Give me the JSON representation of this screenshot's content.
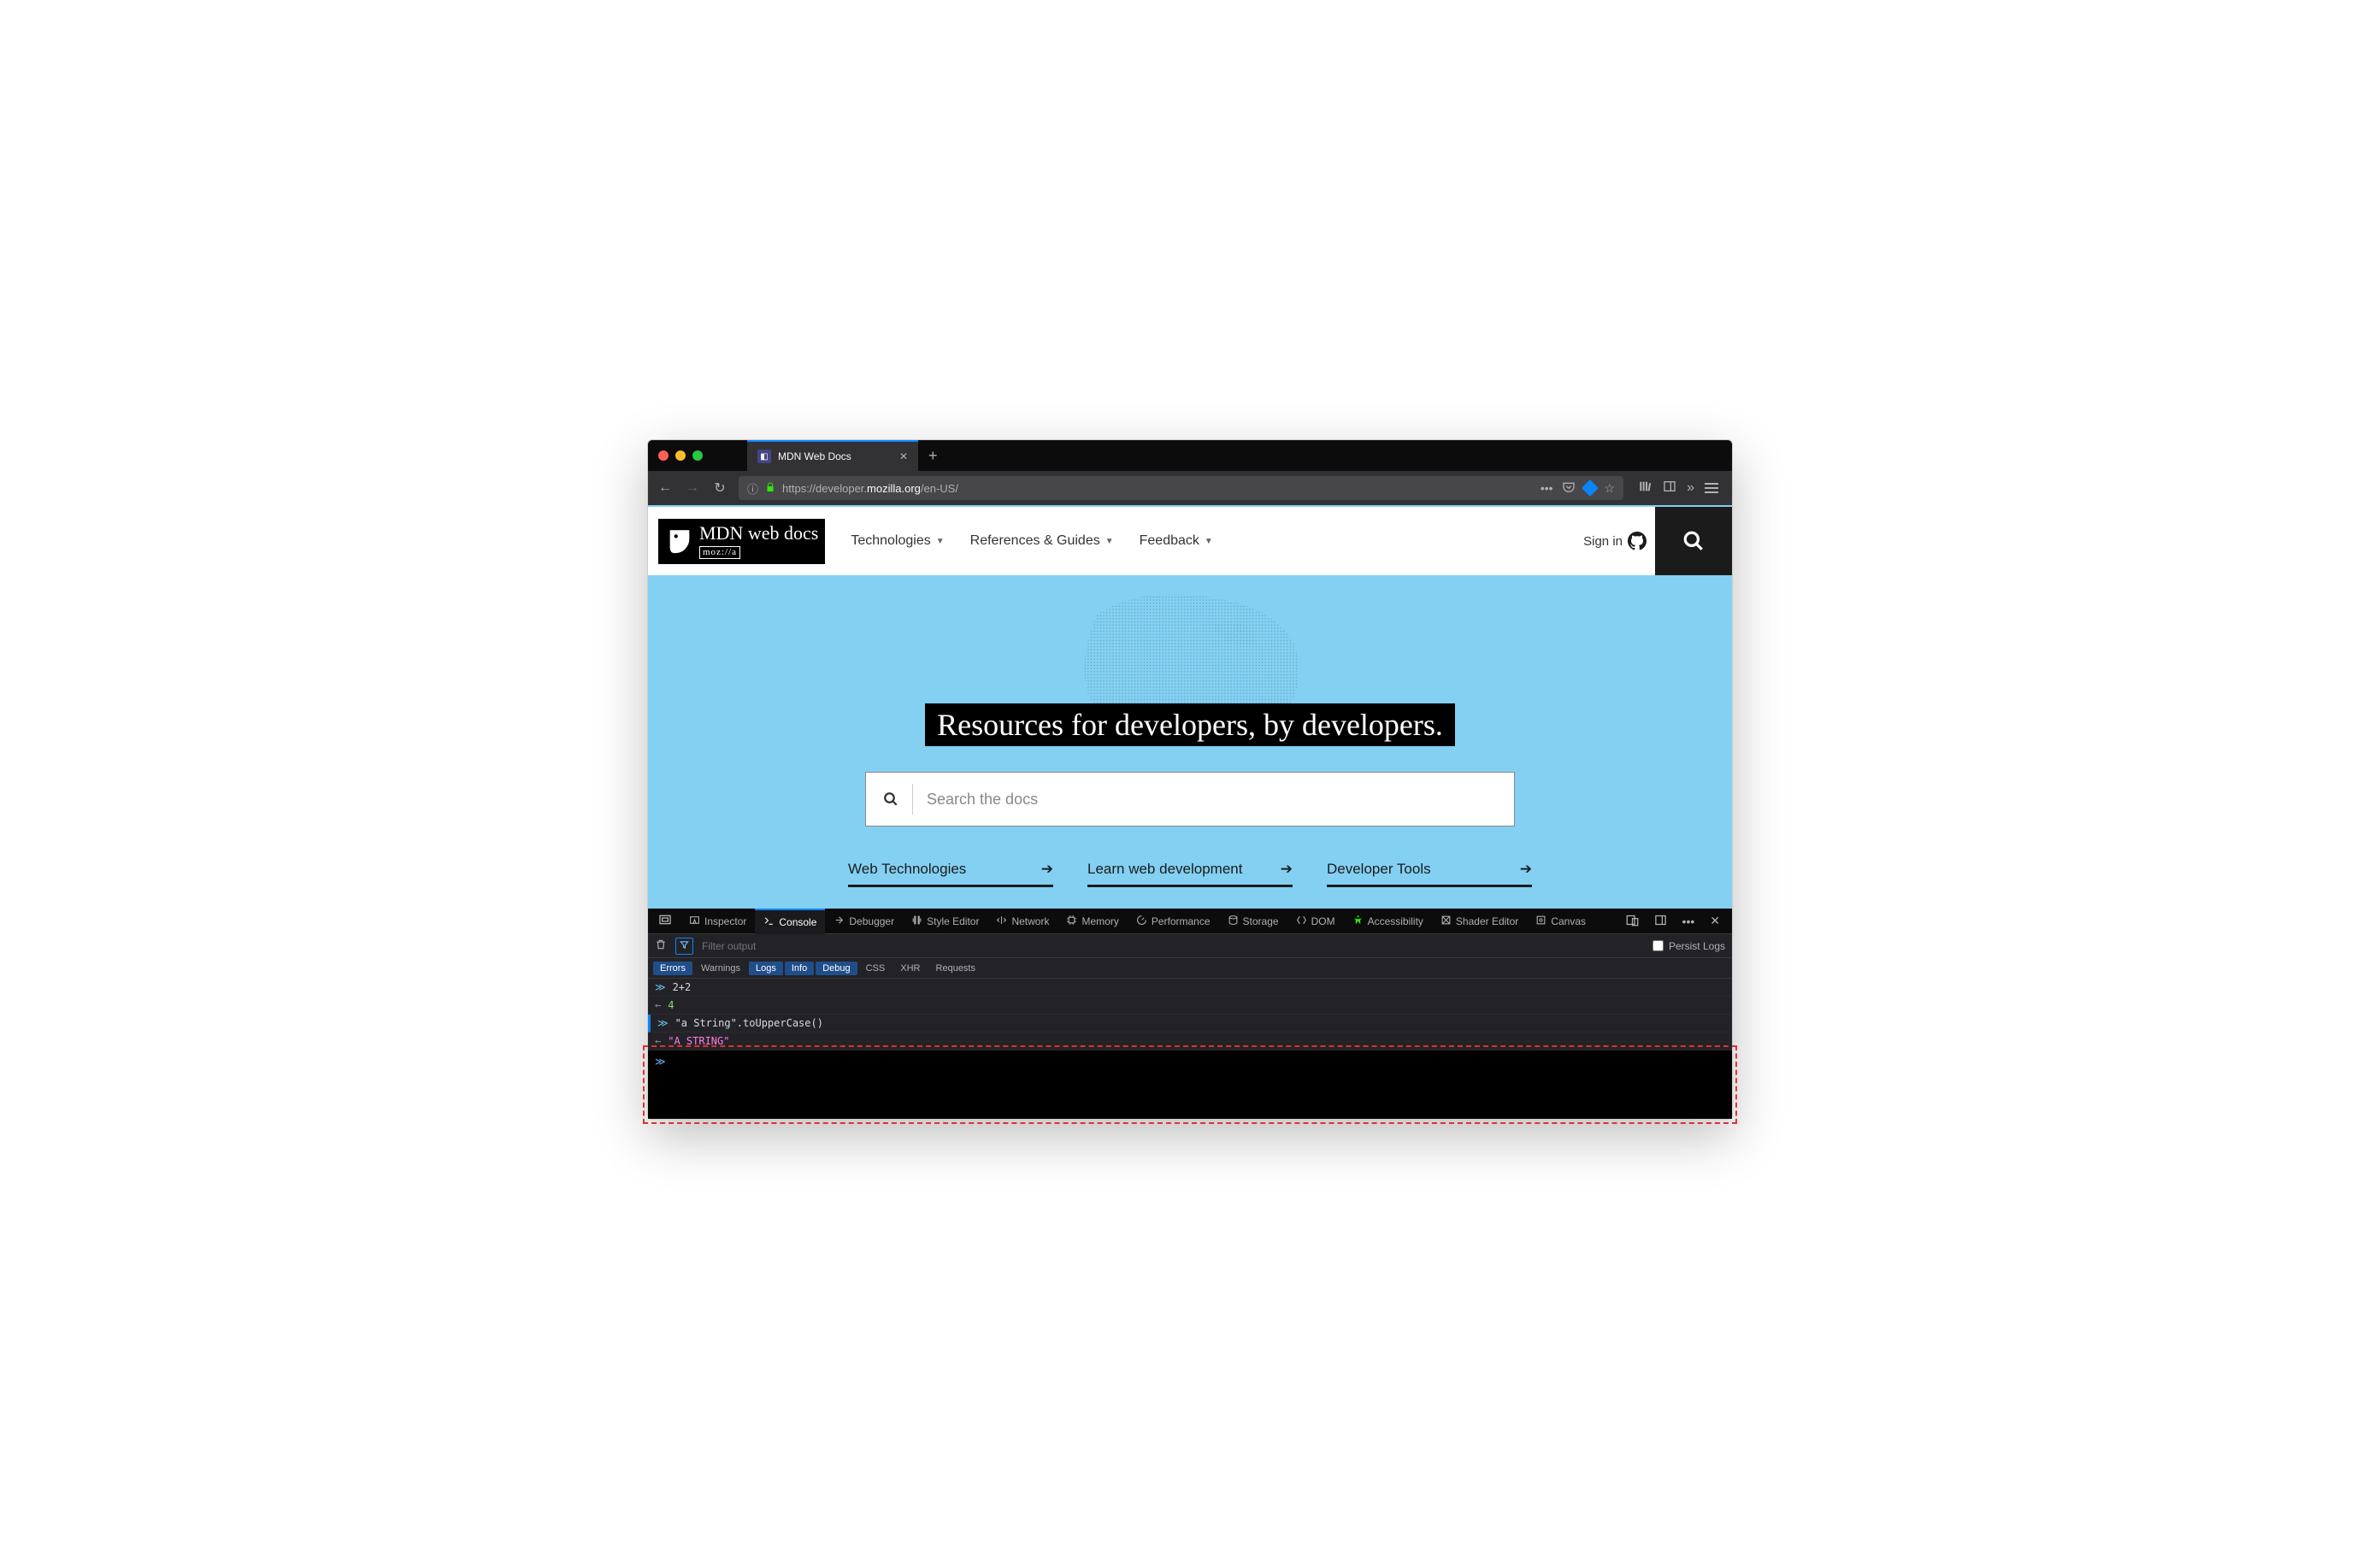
{
  "browser": {
    "tab_title": "MDN Web Docs",
    "url_prefix": "https://developer.",
    "url_highlight": "mozilla.org",
    "url_suffix": "/en-US/"
  },
  "nav": {
    "logo_main": "MDN web docs",
    "logo_sub": "moz://a",
    "menu": [
      "Technologies",
      "References & Guides",
      "Feedback"
    ],
    "signin": "Sign in"
  },
  "hero": {
    "title": "Resources for developers, by developers.",
    "search_placeholder": "Search the docs",
    "quick_links": [
      "Web Technologies",
      "Learn web development",
      "Developer Tools"
    ]
  },
  "devtools": {
    "tabs": [
      "Inspector",
      "Console",
      "Debugger",
      "Style Editor",
      "Network",
      "Memory",
      "Performance",
      "Storage",
      "DOM",
      "Accessibility",
      "Shader Editor",
      "Canvas"
    ],
    "active_tab": "Console",
    "filter_placeholder": "Filter output",
    "persist_label": "Persist Logs",
    "filters": [
      "Errors",
      "Warnings",
      "Logs",
      "Info",
      "Debug",
      "CSS",
      "XHR",
      "Requests"
    ],
    "filters_active": [
      "Errors",
      "Logs",
      "Info",
      "Debug"
    ]
  },
  "console": {
    "lines": [
      {
        "type": "in",
        "text": "2+2"
      },
      {
        "type": "out",
        "text": "4",
        "class": "num"
      },
      {
        "type": "in",
        "text": "\"a String\".toUpperCase()"
      },
      {
        "type": "out",
        "text": "\"A STRING\"",
        "class": "str"
      }
    ]
  }
}
